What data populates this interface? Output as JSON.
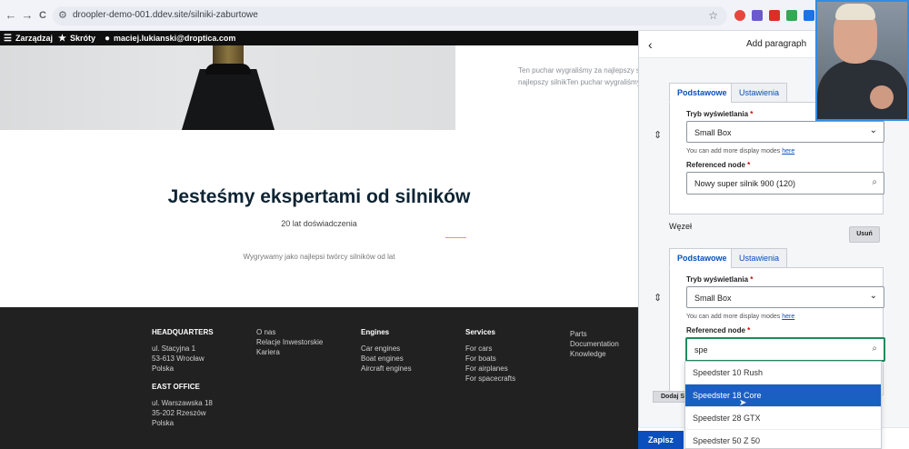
{
  "browser": {
    "url": "droopler-demo-001.ddev.site/silniki-zaburtowe",
    "back": "←",
    "forward": "→",
    "reload": "C",
    "tune": "⚙",
    "star": "☆"
  },
  "toolbar": {
    "manage": "Zarządzaj",
    "shortcuts": "Skróty",
    "user": "maciej.lukianski@droptica.com"
  },
  "hero": {
    "cup_text_1": "Ten puchar wygraliśmy za najlepszy silni",
    "cup_text_2": "najlepszy silnikTen puchar wygraliśmy"
  },
  "section": {
    "heading": "Jesteśmy ekspertami od silników",
    "subheading": "20 lat doświadczenia",
    "lead": "Wygrywamy jako najlepsi twórcy silników od lat"
  },
  "footer": {
    "hq": {
      "title": "HEADQUARTERS",
      "lines": [
        "ul. Stacyjna 1",
        "53-613 Wrocław",
        "Polska"
      ]
    },
    "east": {
      "title": "EAST OFFICE",
      "lines": [
        "ul. Warszawska 18",
        "35-202 Rzeszów",
        "Polska"
      ]
    },
    "col2": [
      "O nas",
      "Relacje Inwestorskie",
      "Kariera"
    ],
    "engines": {
      "title": "Engines",
      "links": [
        "Car engines",
        "Boat engines",
        "Aircraft engines"
      ]
    },
    "services": {
      "title": "Services",
      "links": [
        "For cars",
        "For boats",
        "For airplanes",
        "For spacecrafts"
      ]
    },
    "col5": [
      "Parts",
      "Documentation",
      "Knowledge"
    ]
  },
  "panel": {
    "back_icon": "‹",
    "title": "Add paragraph",
    "drag_icon": "⇕",
    "tab_basic": "Podstawowe",
    "tab_settings": "Ustawienia",
    "display_mode_label": "Tryb wyświetlania",
    "required_mark": "*",
    "display_mode_value": "Small Box",
    "hint_text": "You can add more display modes ",
    "hint_link": "here",
    "ref_label": "Referenced node",
    "ref1_value": "Nowy super silnik 900 (120)",
    "node_label": "Węzeł",
    "remove_label": "Usuń",
    "ref2_value": "spe",
    "add_label": "Dodaj Si",
    "save_label": "Zapisz"
  },
  "autocomplete": [
    "Speedster 10 Rush",
    "Speedster 18 Core",
    "Speedster 28 GTX",
    "Speedster 50 Z 50"
  ],
  "colors": {
    "accent": "#e3a62f",
    "primary": "#0a4fbd",
    "selection": "#1b5fc2",
    "focus": "#1f8a5a",
    "footer_bg": "#212122"
  }
}
